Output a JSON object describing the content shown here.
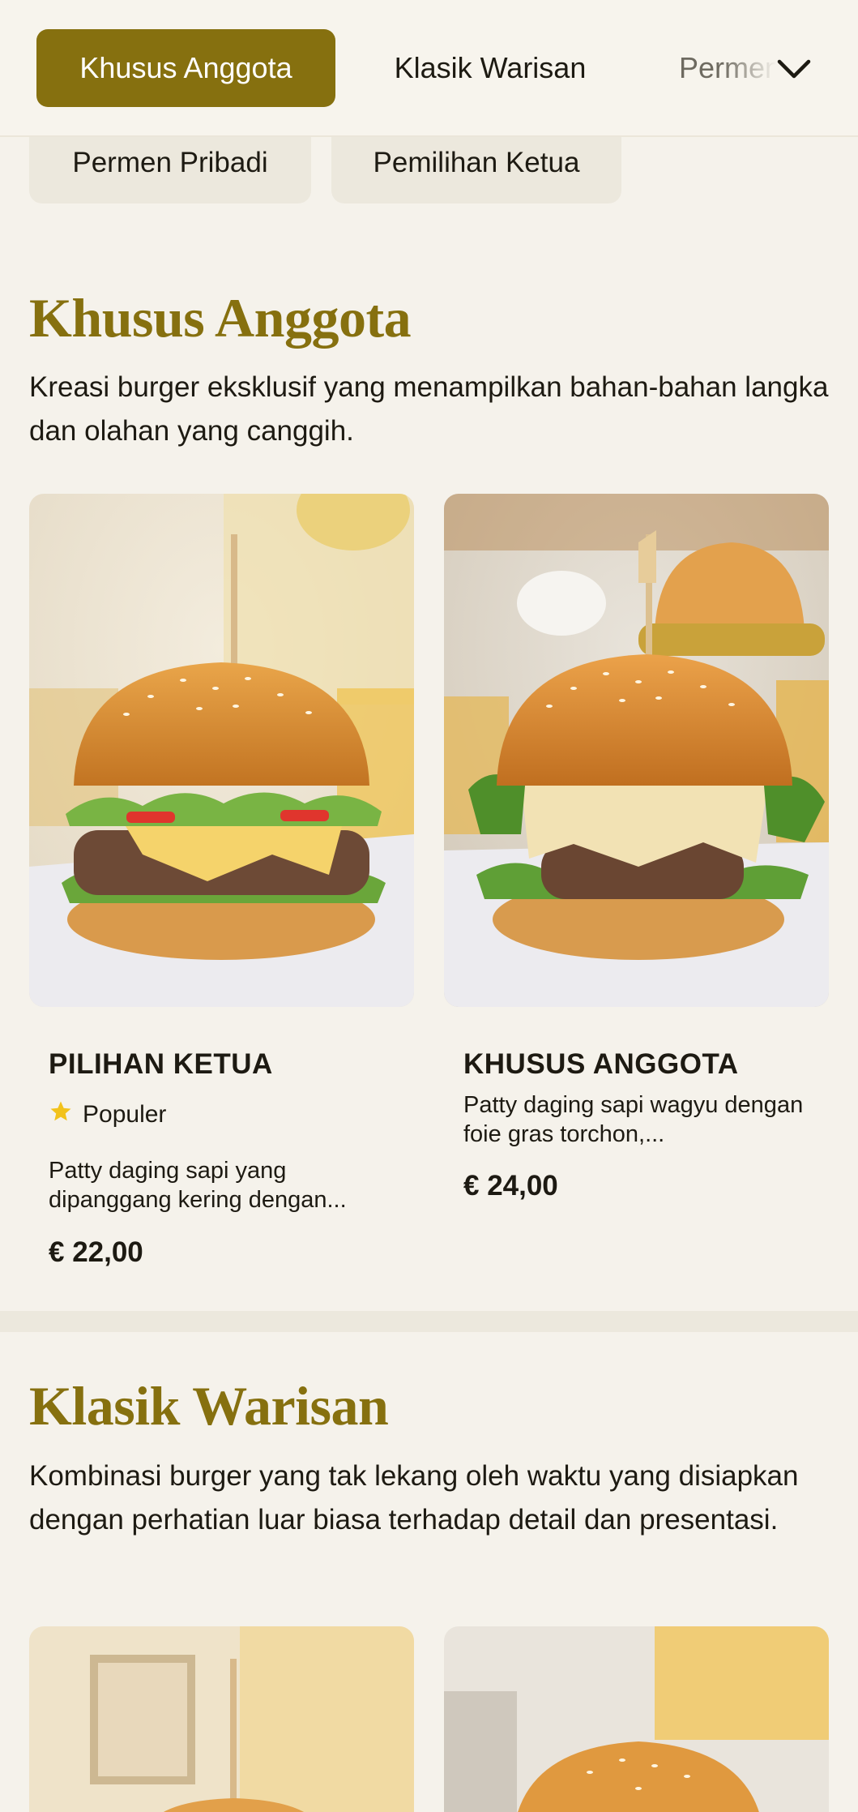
{
  "nav": {
    "categories": [
      "Khusus Anggota",
      "Klasik Warisan",
      "Permen Pribadi"
    ],
    "categories_row2": [
      "Permen Pribadi",
      "Pemilihan Ketua"
    ],
    "active_index": 0,
    "expand_icon": "chevron-down-icon"
  },
  "sections": [
    {
      "title": "Khusus Anggota",
      "description": "Kreasi burger eksklusif yang menampilkan bahan-bahan langka dan olahan yang canggih.",
      "items": [
        {
          "name": "PILIHAN KETUA",
          "badge": "Populer",
          "badge_icon": "star-icon",
          "description": "Patty daging sapi yang dipanggang kering dengan...",
          "price": "€ 22,00"
        },
        {
          "name": "KHUSUS ANGGOTA",
          "description": "Patty daging sapi wagyu dengan foie gras torchon,...",
          "price": "€ 24,00"
        }
      ]
    },
    {
      "title": "Klasik Warisan",
      "description": "Kombinasi burger yang tak lekang oleh waktu yang disiapkan dengan perhatian luar biasa terhadap detail dan presentasi."
    }
  ],
  "colors": {
    "accent": "#86700f",
    "background": "#f5f2eb",
    "pill": "#ece8dd",
    "star": "#f2c21b"
  }
}
